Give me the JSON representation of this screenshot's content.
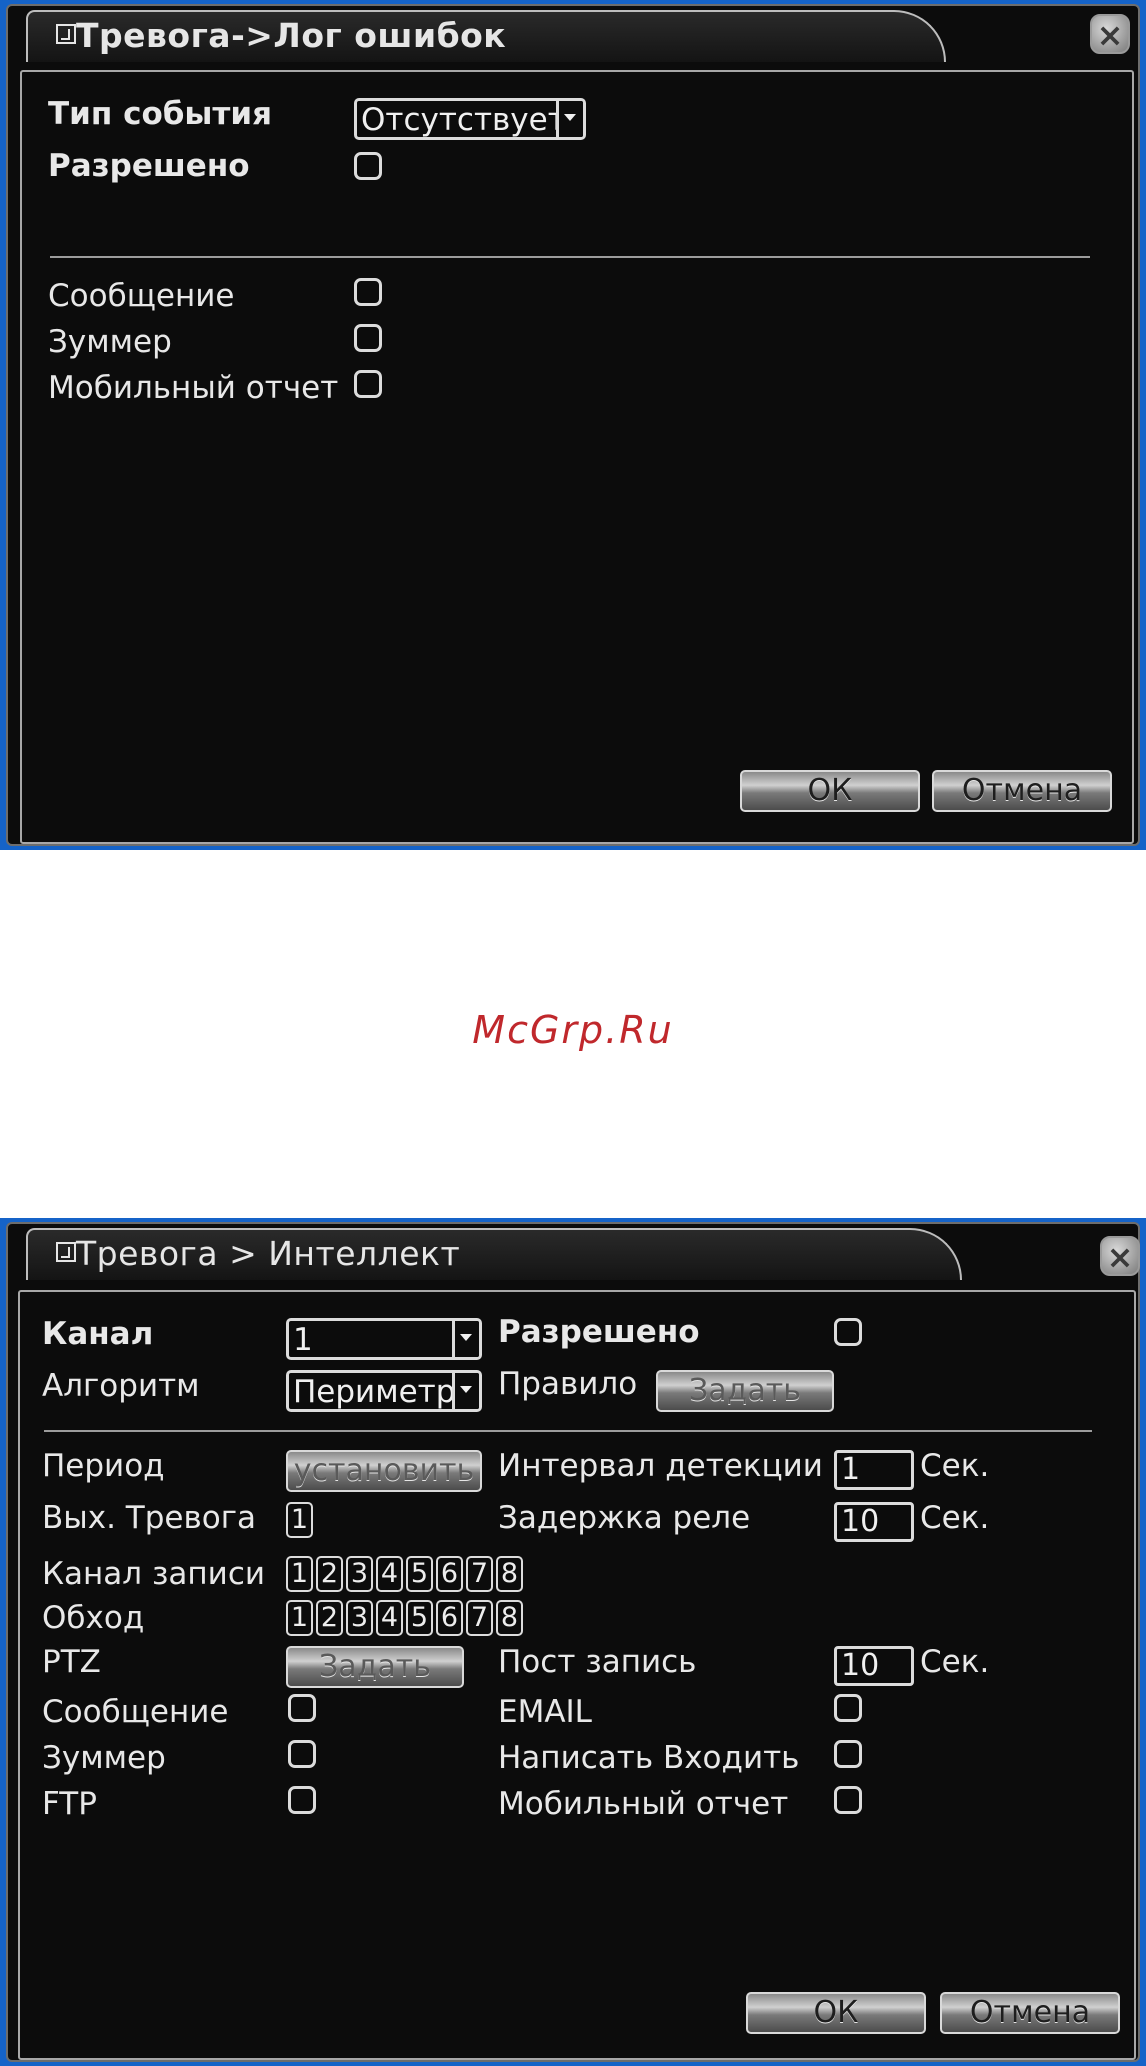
{
  "dialog1": {
    "title": "Тревога->Лог ошибок",
    "event_type_label": "Тип события",
    "event_type_value": "Отсутствует",
    "enabled_label": "Разрешено",
    "message_label": "Сообщение",
    "buzzer_label": "Зуммер",
    "mobile_report_label": "Мобильный отчет",
    "ok_label": "ОК",
    "cancel_label": "Отмена"
  },
  "watermark": "McGrp.Ru",
  "dialog2": {
    "title": "Тревога > Интеллект",
    "channel_label": "Канал",
    "channel_value": "1",
    "enabled_label": "Разрешено",
    "algorithm_label": "Алгоритм",
    "algorithm_value": "Периметр",
    "rule_label": "Правило",
    "rule_button": "Задать",
    "period_label": "Период",
    "period_button": "установить",
    "detect_interval_label": "Интервал детекции",
    "detect_interval_value": "1",
    "sec_label": "Сек.",
    "alarm_out_label": "Вых. Тревога",
    "alarm_out_value": "1",
    "relay_delay_label": "Задержка реле",
    "relay_delay_value": "10",
    "record_channel_label": "Канал записи",
    "tour_label": "Обход",
    "channels": [
      "1",
      "2",
      "3",
      "4",
      "5",
      "6",
      "7",
      "8"
    ],
    "ptz_label": "PTZ",
    "ptz_button": "Задать",
    "post_record_label": "Пост запись",
    "post_record_value": "10",
    "message_label": "Сообщение",
    "email_label": "EMAIL",
    "buzzer_label": "Зуммер",
    "write_login_label": "Написать Входить",
    "ftp_label": "FTP",
    "mobile_report_label": "Мобильный отчет",
    "ok_label": "ОК",
    "cancel_label": "Отмена"
  }
}
